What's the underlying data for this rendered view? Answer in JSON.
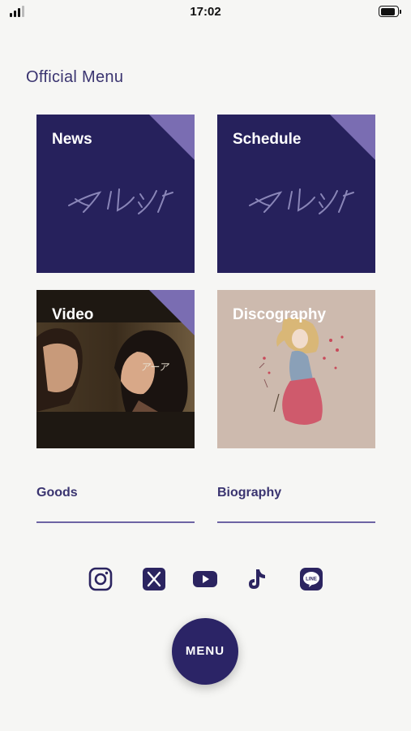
{
  "status_bar": {
    "time": "17:02"
  },
  "page": {
    "title": "Official Menu"
  },
  "tiles": [
    {
      "label": "News",
      "logo_text": "マルシィ"
    },
    {
      "label": "Schedule",
      "logo_text": "マルシィ"
    },
    {
      "label": "Video",
      "image_text": "アーア"
    },
    {
      "label": "Discography"
    }
  ],
  "links": [
    {
      "label": "Goods"
    },
    {
      "label": "Biography"
    }
  ],
  "social": [
    {
      "name": "instagram-icon"
    },
    {
      "name": "x-icon"
    },
    {
      "name": "youtube-icon"
    },
    {
      "name": "tiktok-icon"
    },
    {
      "name": "line-icon",
      "text": "LINE"
    }
  ],
  "menu_button": {
    "label": "MENU"
  },
  "colors": {
    "navy": "#26215c",
    "accent": "#7a6db2",
    "background": "#f6f6f4"
  }
}
